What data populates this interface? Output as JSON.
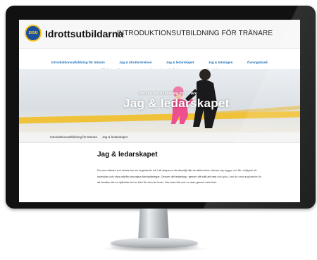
{
  "site": {
    "brand": "Idrottsutbildarna",
    "logo_text": "SISU",
    "page_heading": "INTRODUKTIONSUTBILDNING FÖR TRÄNARE"
  },
  "nav": {
    "row1": [
      "Introduktionsutbildning för tränare",
      "Jag & idrottsrörelsen",
      "Jag & ledarskapet",
      "Jag & träningen",
      "Övningsbank"
    ],
    "row2": [
      "Vill du lära dig mer?",
      "Registrering och diplom",
      "Testa dig själv"
    ]
  },
  "hero": {
    "subtitle": "Introduktionsutbildning för tränare",
    "title": "Jag & ledarskapet"
  },
  "breadcrumb": {
    "items": [
      "Introduktionsutbildning för tränare",
      "Jag & ledarskapet"
    ],
    "separator": "»"
  },
  "content": {
    "title": "Jag & ledarskapet",
    "paragraph": "Du som tränare och ledare har en avgörande roll i att skapa en idrottsmiljö där de aktiva trivs, känner sig trygga och får möjlighet att utvecklas och växa utifrån sina egna förutsättningar. Genom ditt ledarskap, genom ditt sätt att vara och göra, kan du vara avgörande för att idrotten blir en självklar del av livet för dem du leder. Inte bara här och nu utan genom hela livet."
  },
  "colors": {
    "link_blue": "#1d6fb8",
    "logo_blue": "#1c4fa0",
    "logo_gold": "#f2c418",
    "hero_stripe": "#f0c23a"
  }
}
